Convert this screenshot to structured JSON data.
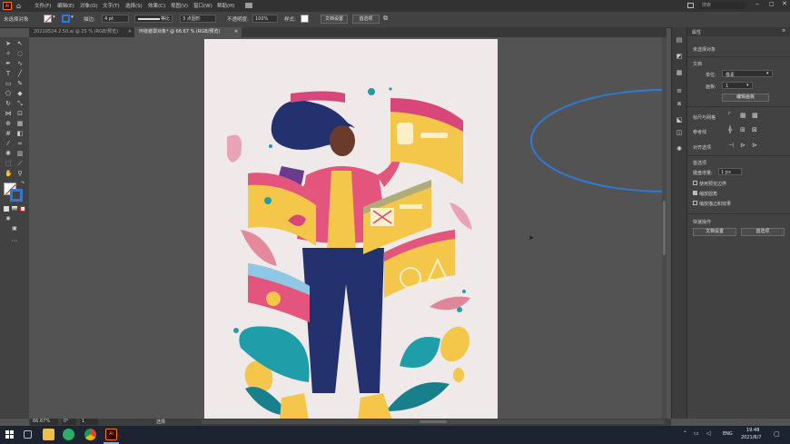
{
  "menubar": {
    "app_badge": "Ai",
    "items": [
      "文件(F)",
      "编辑(E)",
      "对象(O)",
      "文字(T)",
      "选择(S)",
      "效果(C)",
      "视图(V)",
      "窗口(W)",
      "帮助(H)"
    ],
    "workspace_label": "搜索"
  },
  "control": {
    "selection_label": "未选择对象",
    "stroke_label": "描边:",
    "stroke_weight": "4 pt",
    "brush_label": "等比",
    "profile_label": "3 点圆形",
    "opacity_label": "不透明度:",
    "opacity_value": "100%",
    "style_label": "样式:",
    "doc_setup": "文档设置",
    "preferences": "首选项"
  },
  "tabs": [
    {
      "label": "20210524 2.50.ai @ 25 % (RGB/预览)",
      "active": false
    },
    {
      "label": "环绕遮罩对象* @ 66.67 % (RGB/预览)",
      "active": true
    }
  ],
  "properties": {
    "title": "属性",
    "no_selection": "未选择对象",
    "document_heading": "文档",
    "units_label": "单位:",
    "units_value": "像素",
    "artboard_label": "画板:",
    "artboard_value": "1",
    "edit_artboards": "编辑画板",
    "rulers_label": "标尺与网格",
    "guides_label": "参考线",
    "snap_label": "对齐选项",
    "prefs_heading": "首选项",
    "keyboard_inc_label": "键盘增量:",
    "keyboard_inc_value": "1 px",
    "cb_preview_bounds": "使用预览边界",
    "cb_scale_corners": "缩放圆角",
    "cb_scale_strokes": "缩放描边和效果",
    "quick_actions": "快速操作",
    "doc_setup_btn": "文档设置",
    "prefs_btn": "首选项"
  },
  "status": {
    "zoom": "66.67%",
    "rotation": "0°",
    "artboard_nav": "1",
    "tool_name": "选择"
  },
  "taskbar": {
    "time": "19:48",
    "date": "2021/6/7",
    "lang": "ENG"
  },
  "colors": {
    "accent": "#1a73e8",
    "ellipse": "#2f79d6",
    "artboard": "#efe9e9",
    "pink": "#d9467a",
    "yellow": "#f4c64a",
    "navy": "#23326e",
    "teal": "#1f9eaa"
  }
}
